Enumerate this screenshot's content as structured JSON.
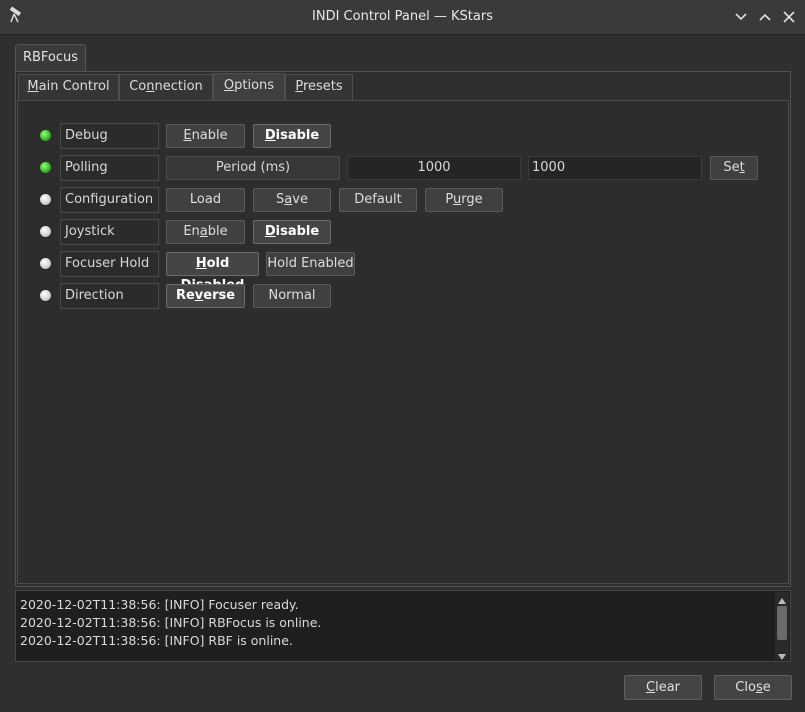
{
  "window": {
    "title": "INDI Control Panel — KStars",
    "icons": [
      "telescope-icon",
      "minimize-icon",
      "maximize-icon",
      "close-icon"
    ]
  },
  "device_tab": "RBFocus",
  "tabs": [
    {
      "label": "Main Control",
      "accel": "M",
      "rest": "ain Control"
    },
    {
      "label": "Connection",
      "pre": "Co",
      "accel": "n",
      "rest": "nection"
    },
    {
      "label": "Options",
      "accel": "O",
      "rest": "ptions"
    },
    {
      "label": "Presets",
      "accel": "P",
      "rest": "resets"
    }
  ],
  "active_tab": "Options",
  "properties": {
    "debug": {
      "label": "Debug",
      "state": "ok",
      "enable_accel": "E",
      "enable_rest": "nable",
      "disable_accel": "D",
      "disable_rest": "isable",
      "active": "Disable"
    },
    "polling": {
      "label": "Polling",
      "state": "ok",
      "element": "Period (ms)",
      "current": "1000",
      "input": "1000",
      "set_accel": "t",
      "set_pre": "Se"
    },
    "configuration": {
      "label": "Configuration",
      "state": "idle",
      "load": "Load",
      "save_pre": "S",
      "save_accel": "a",
      "save_rest": "ve",
      "default": "Default",
      "purge_pre": "P",
      "purge_accel": "u",
      "purge_rest": "rge"
    },
    "joystick": {
      "label": "Joystick",
      "state": "idle",
      "enable_pre": "En",
      "enable_accel": "a",
      "enable_rest": "ble",
      "disable_accel": "D",
      "disable_rest": "isable",
      "active": "Disable"
    },
    "focuser_hold": {
      "label": "Focuser Hold",
      "state": "idle",
      "hold_disabled_accel": "H",
      "hold_disabled_rest": "old Disabled",
      "hold_enabled": "Hold Enabled",
      "active": "Hold Disabled"
    },
    "direction": {
      "label": "Direction",
      "state": "idle",
      "reverse_pre": "Re",
      "reverse_accel": "v",
      "reverse_rest": "erse",
      "normal": "Normal",
      "active": "Reverse"
    }
  },
  "log": [
    "2020-12-02T11:38:56: [INFO] Focuser ready.",
    "2020-12-02T11:38:56: [INFO] RBFocus is online.",
    "2020-12-02T11:38:56: [INFO] RBF is online."
  ],
  "buttons": {
    "clear_accel": "C",
    "clear_rest": "lear",
    "close_pre": "Clo",
    "close_accel": "s",
    "close_rest": "e"
  },
  "colors": {
    "led_ok": "#2fb81d",
    "led_idle": "#cfcfcf",
    "background": "#2f2f2f"
  }
}
